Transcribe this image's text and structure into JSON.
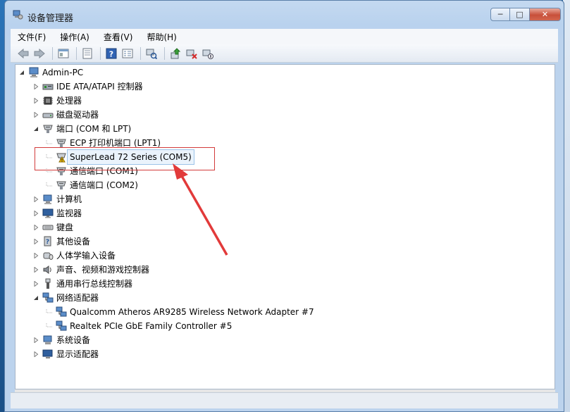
{
  "window": {
    "title": "设备管理器"
  },
  "caption": {
    "minimize": "─",
    "maximize": "□",
    "close": "✕"
  },
  "menu": [
    "文件(F)",
    "操作(A)",
    "查看(V)",
    "帮助(H)"
  ],
  "tree": {
    "root": "Admin-PC",
    "nodes": [
      {
        "label": "IDE ATA/ATAPI 控制器",
        "icon": "ide-controller-icon",
        "expanded": false
      },
      {
        "label": "处理器",
        "icon": "processor-icon",
        "expanded": false
      },
      {
        "label": "磁盘驱动器",
        "icon": "disk-drive-icon",
        "expanded": false
      },
      {
        "label": "端口 (COM 和 LPT)",
        "icon": "port-icon",
        "expanded": true,
        "children": [
          {
            "label": "ECP 打印机端口 (LPT1)",
            "icon": "port-icon"
          },
          {
            "label": "SuperLead 72 Series (COM5)",
            "icon": "port-warning-icon",
            "selected": true
          },
          {
            "label": "通信端口 (COM1)",
            "icon": "port-icon"
          },
          {
            "label": "通信端口 (COM2)",
            "icon": "port-icon"
          }
        ]
      },
      {
        "label": "计算机",
        "icon": "computer-icon",
        "expanded": false
      },
      {
        "label": "监视器",
        "icon": "monitor-icon",
        "expanded": false
      },
      {
        "label": "键盘",
        "icon": "keyboard-icon",
        "expanded": false
      },
      {
        "label": "其他设备",
        "icon": "other-devices-icon",
        "expanded": false
      },
      {
        "label": "人体学输入设备",
        "icon": "hid-icon",
        "expanded": false
      },
      {
        "label": "声音、视频和游戏控制器",
        "icon": "sound-icon",
        "expanded": false
      },
      {
        "label": "通用串行总线控制器",
        "icon": "usb-icon",
        "expanded": false
      },
      {
        "label": "网络适配器",
        "icon": "network-adapter-icon",
        "expanded": true,
        "children": [
          {
            "label": "Qualcomm Atheros AR9285 Wireless Network Adapter #7",
            "icon": "network-adapter-icon"
          },
          {
            "label": "Realtek PCIe GbE Family Controller #5",
            "icon": "network-adapter-icon"
          }
        ]
      },
      {
        "label": "系统设备",
        "icon": "system-devices-icon",
        "expanded": false
      },
      {
        "label": "显示适配器",
        "icon": "display-adapter-icon",
        "expanded": false
      }
    ]
  },
  "colors": {
    "highlight": "#d33b3b",
    "selection": "#eaf3fc"
  }
}
